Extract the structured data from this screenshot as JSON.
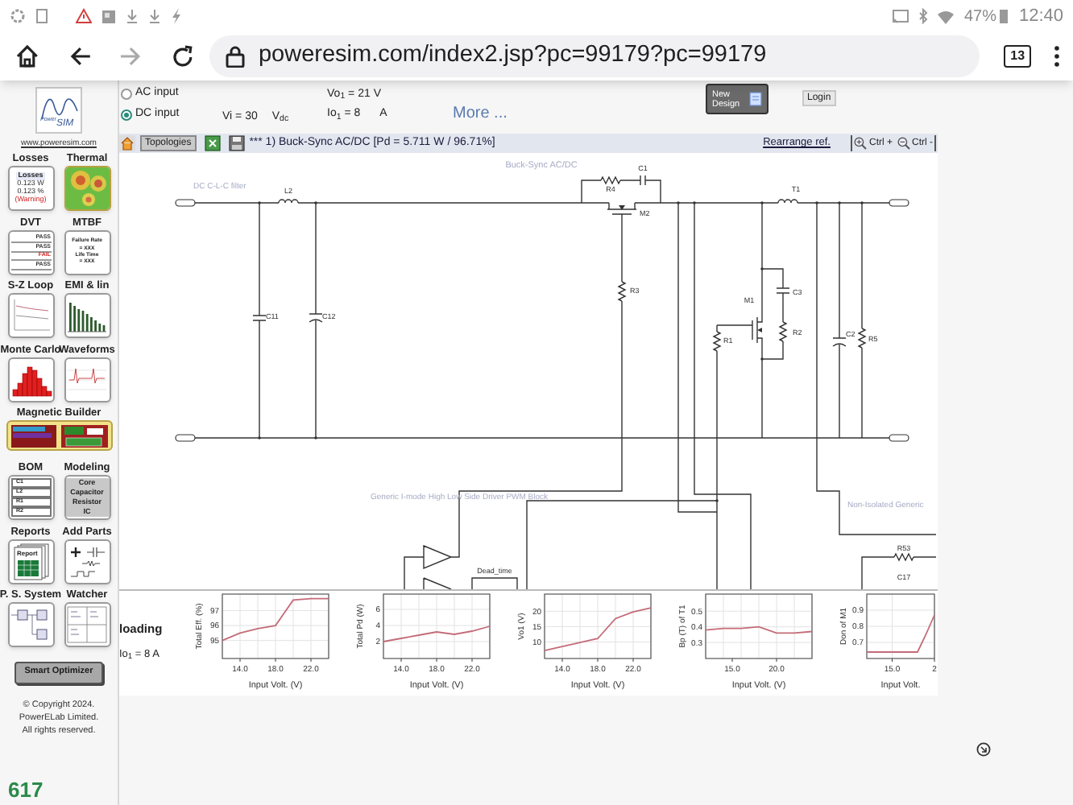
{
  "status_bar": {
    "battery": "47%",
    "time": "12:40"
  },
  "browser": {
    "url": "poweresim.com/index2.jsp?pc=99179?pc=99179",
    "tab_count": "13"
  },
  "logo": {
    "small_text": "Power",
    "large_text": "SIM",
    "link": "www.poweresim.com"
  },
  "tools": [
    {
      "label": "Losses",
      "kind": "losses",
      "title": "Losses",
      "lines": [
        "0.123 W",
        "0.123 %"
      ],
      "warning": "(Warning)"
    },
    {
      "label": "Thermal",
      "kind": "thermal"
    },
    {
      "label": "DVT",
      "kind": "dvt",
      "checks": [
        {
          "text": "PASS",
          "passed": true
        },
        {
          "text": "PASS",
          "passed": true
        },
        {
          "text": "FAIL",
          "passed": false
        },
        {
          "text": "PASS",
          "passed": true
        }
      ]
    },
    {
      "label": "MTBF",
      "kind": "mtbf",
      "lines": [
        "Failure Rate",
        "= XXX",
        "Life Time",
        "= XXX"
      ]
    },
    {
      "label": "S-Z Loop",
      "kind": "sz_loop"
    },
    {
      "label": "EMI & lin",
      "kind": "emi"
    },
    {
      "label": "Monte Carlo",
      "kind": "monte_carlo"
    },
    {
      "label": "Waveforms",
      "kind": "waveforms"
    },
    {
      "label": "Magnetic Builder",
      "kind": "magnetic"
    },
    {
      "label": "BOM",
      "kind": "bom",
      "lines": [
        "C1",
        "L2",
        "R1",
        "R2"
      ]
    },
    {
      "label": "Modeling",
      "kind": "modeling",
      "lines": [
        "Core",
        "Capacitor",
        "Resistor",
        "IC"
      ]
    },
    {
      "label": "Reports",
      "kind": "reports",
      "lines": [
        "Report"
      ]
    },
    {
      "label": "Add Parts",
      "kind": "add_parts"
    },
    {
      "label": "P. S. System",
      "kind": "ps_system"
    },
    {
      "label": "Watcher",
      "kind": "watcher"
    }
  ],
  "smart_optimizer": "Smart Optimizer",
  "copyright": [
    "© Copyright 2024.",
    "PowerELab Limited.",
    "All rights reserved."
  ],
  "counter": "617",
  "input_types": [
    {
      "label": "AC input",
      "selected": false
    },
    {
      "label": "DC input",
      "selected": true
    }
  ],
  "vi": {
    "label": "Vi = 30",
    "unit": "V$_{dc}$"
  },
  "vo1": "Vo$_{1}$ = 21 V",
  "io1": {
    "label": "Io$_{1}$ = 8",
    "unit": "A"
  },
  "more_link": "More ...",
  "new_design": "New Design",
  "login": "Login",
  "toolbar": {
    "topologies": "Topologies",
    "title": "*** 1) Buck-Sync AC/DC [Pd = 5.711 W / 96.71%]",
    "rearrange": "Rearrange ref.",
    "zoom_buttons": [
      "Ctrl +",
      "Ctrl -"
    ]
  },
  "schematic": {
    "title": "Buck-Sync AC/DC",
    "blocks": [
      "DC C-L-C filter",
      "Generic I-mode High Low Side Driver PWM Block",
      "Non-Isolated Generic"
    ],
    "parts": [
      "L2",
      "C11",
      "C12",
      "R4",
      "C1",
      "M2",
      "R3",
      "T1",
      "M1",
      "C3",
      "R2",
      "R1",
      "C2",
      "R5",
      "R53",
      "C17"
    ],
    "dead_time": "Dead_time"
  },
  "status": {
    "loading": "loading",
    "io1": "Io$_{1}$ = 8 A"
  },
  "charts": [
    {
      "chart_data": {
        "type": "line",
        "grid": true,
        "xlabel": "Input Volt. (V)",
        "ylabel": "Total Eff. (%)",
        "x": [
          12,
          14,
          16,
          18,
          20,
          22,
          24
        ],
        "xlim": [
          12,
          24
        ],
        "ylim": [
          93.8,
          98.1
        ],
        "xticks": [
          {
            "value": 14,
            "label": "14.0"
          },
          {
            "value": 18,
            "label": "18.0"
          },
          {
            "value": 22,
            "label": "22.0"
          }
        ],
        "yticks": [
          95,
          96,
          97
        ],
        "series": [
          {
            "color": "#c46b78",
            "values": [
              95.0,
              95.5,
              95.8,
              96.0,
              97.7,
              97.8,
              97.8
            ]
          }
        ]
      }
    },
    {
      "chart_data": {
        "type": "line",
        "grid": true,
        "xlabel": "Input Volt. (V)",
        "ylabel": "Total Pd (W)",
        "x": [
          12,
          14,
          16,
          18,
          20,
          22,
          24
        ],
        "xlim": [
          12,
          24
        ],
        "ylim": [
          -0.1,
          7.9
        ],
        "xticks": [
          {
            "value": 14,
            "label": "14.0"
          },
          {
            "value": 18,
            "label": "18.0"
          },
          {
            "value": 22,
            "label": "22.0"
          }
        ],
        "yticks": [
          2,
          4,
          6
        ],
        "series": [
          {
            "color": "#c46b78",
            "values": [
              2.0,
              2.4,
              2.8,
              3.2,
              2.9,
              3.3,
              3.9
            ]
          }
        ]
      }
    },
    {
      "chart_data": {
        "type": "line",
        "grid": true,
        "xlabel": "Input Volt. (V)",
        "ylabel": "Vo1 (V)",
        "x": [
          12,
          14,
          16,
          18,
          20,
          22,
          24
        ],
        "xlim": [
          12,
          24
        ],
        "ylim": [
          4.6,
          25.6
        ],
        "xticks": [
          {
            "value": 14,
            "label": "14.0"
          },
          {
            "value": 18,
            "label": "18.0"
          },
          {
            "value": 22,
            "label": "22.0"
          }
        ],
        "yticks": [
          10,
          15,
          20
        ],
        "series": [
          {
            "color": "#c46b78",
            "values": [
              7.2,
              8.5,
              9.8,
              11.1,
              17.6,
              19.8,
              21.1
            ]
          }
        ]
      }
    },
    {
      "chart_data": {
        "type": "line",
        "grid": true,
        "xlabel": "Input Volt. (V)",
        "ylabel": "Bp (T) of T1",
        "x": [
          12,
          14,
          16,
          18,
          20,
          22,
          24
        ],
        "xlim": [
          12,
          24
        ],
        "ylim": [
          0.198,
          0.609
        ],
        "xticks": [
          {
            "value": 15,
            "label": "15.0"
          },
          {
            "value": 20,
            "label": "20.0"
          }
        ],
        "yticks": [
          0.3,
          0.4,
          0.5
        ],
        "series": [
          {
            "color": "#c46b78",
            "values": [
              0.38,
              0.39,
              0.39,
              0.4,
              0.36,
              0.36,
              0.37
            ]
          }
        ]
      }
    },
    {
      "chart_data": {
        "type": "line",
        "grid": true,
        "xlabel": "Input Volt.",
        "ylabel": "Don of M1",
        "categories": [
          null,
          null,
          null,
          "15.0",
          null,
          null,
          null,
          null,
          "2"
        ],
        "ylim": [
          0.6,
          1.0
        ],
        "yticks": [
          0.7,
          0.8,
          0.9
        ],
        "series": [
          {
            "color": "#c46b78",
            "values": [
              0.64,
              0.64,
              0.64,
              0.64,
              0.64,
              0.64,
              0.64,
              0.75,
              0.87
            ]
          }
        ]
      }
    }
  ]
}
